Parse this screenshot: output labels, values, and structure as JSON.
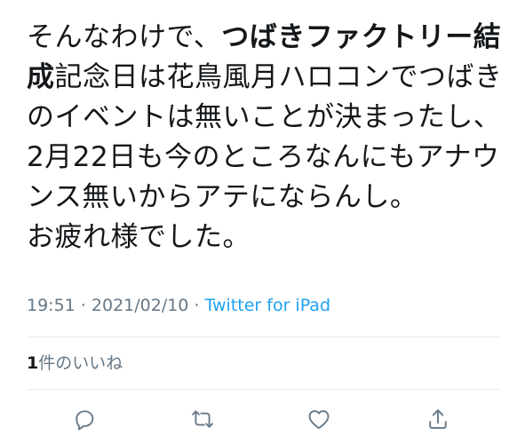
{
  "tweet": {
    "text_lines": [
      {
        "prefix": "そんなわけで、",
        "bold": "つばきファクトリー結",
        "suffix": ""
      },
      {
        "prefix": "",
        "bold": "成",
        "suffix": "記念日は花鳥風月ハロコンでつばき"
      },
      {
        "prefix": "のイベントは無いことが決まったし、",
        "bold": "",
        "suffix": ""
      },
      {
        "prefix": "2月22日も今のところなんにもアナウ",
        "bold": "",
        "suffix": ""
      },
      {
        "prefix": "ンス無いからアテにならんし。",
        "bold": "",
        "suffix": ""
      },
      {
        "prefix": "お疲れ様でした。",
        "bold": "",
        "suffix": ""
      }
    ],
    "time": "19:51",
    "separator": " · ",
    "date": "2021/02/10",
    "source": "Twitter for iPad"
  },
  "likes": {
    "count": "1",
    "label": "件のいいね"
  },
  "actions": {
    "reply_icon": "reply-icon",
    "retweet_icon": "retweet-icon",
    "like_icon": "heart-icon",
    "share_icon": "share-icon",
    "icon_color": "#657786"
  },
  "colors": {
    "text": "#14171a",
    "muted": "#657786",
    "link": "#1da1f2",
    "divider": "#e6ecf0"
  }
}
